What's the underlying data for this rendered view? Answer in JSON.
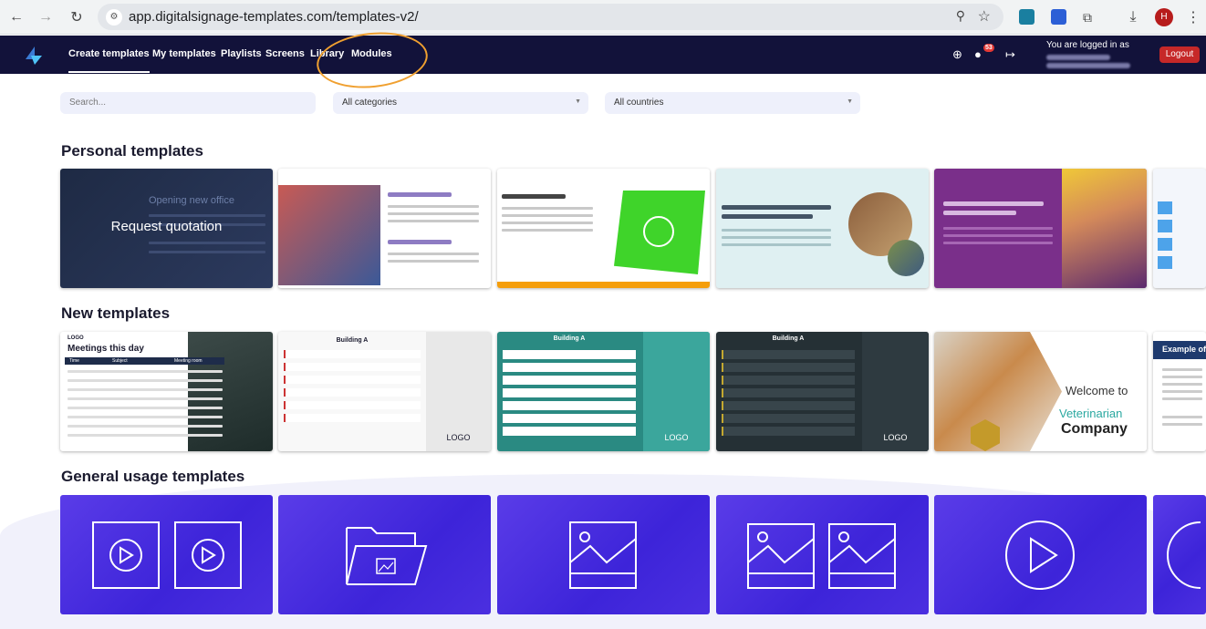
{
  "browser": {
    "url": "app.digitalsignage-templates.com/templates-v2/",
    "profile_initial": "H"
  },
  "nav": {
    "items": [
      "Create templates",
      "My templates",
      "Playlists",
      "Screens",
      "Library",
      "Modules"
    ],
    "notification_count": "53",
    "logged_in_label": "You are logged in as",
    "logout_label": "Logout"
  },
  "filters": {
    "search_placeholder": "Search...",
    "category": "All categories",
    "country": "All countries"
  },
  "sections": {
    "personal": "Personal templates",
    "new": "New templates",
    "general": "General usage templates"
  },
  "personal_tiles": {
    "first_overlay": "Request quotation",
    "first_heading": "Opening new office"
  },
  "new_tiles": {
    "meetings_logo": "LOGO",
    "meetings_title": "Meetings this day",
    "meetings_cols": [
      "Time",
      "Subject",
      "Meeting room"
    ],
    "building_title": "Building A",
    "logo_text": "LOGO",
    "vet_welcome": "Welcome to",
    "vet_name": "Veterinarian",
    "vet_company": "Company",
    "example_title": "Example of"
  },
  "colors": {
    "nav_bg": "#12123a",
    "accent_orange": "#f0a030",
    "logout_red": "#c62828",
    "teal": "#2a8a82",
    "general_purple": "#4b2fe0"
  },
  "icons": [
    "reload-icon",
    "globe-icon",
    "users-icon",
    "exit-icon",
    "play-icon",
    "folder-image-icon",
    "image-icon"
  ]
}
